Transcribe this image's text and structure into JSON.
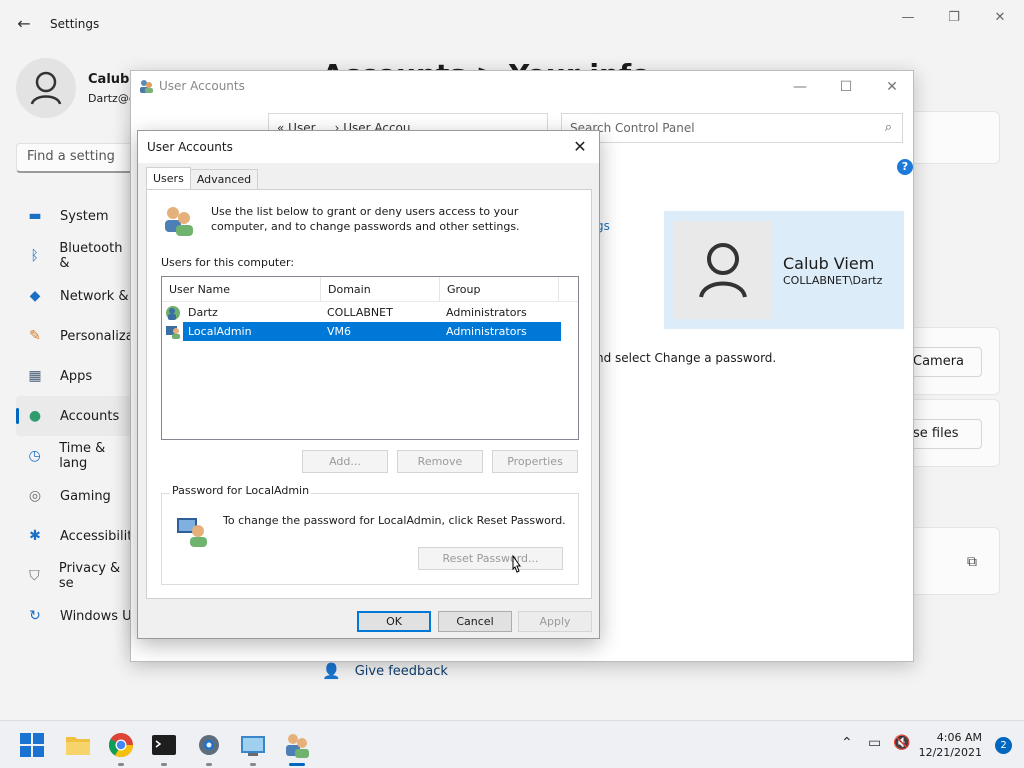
{
  "settings": {
    "title": "Settings",
    "user_name": "Calub V",
    "user_email": "Dartz@c",
    "search_placeholder": "Find a setting",
    "heading": "Accounts  >  Your info",
    "nav": [
      {
        "label": "System",
        "icon": "monitor-icon",
        "color": "#1a6fc4"
      },
      {
        "label": "Bluetooth &",
        "icon": "bluetooth-icon",
        "color": "#1a6fc4"
      },
      {
        "label": "Network &",
        "icon": "wifi-icon",
        "color": "#1a6fc4"
      },
      {
        "label": "Personaliza",
        "icon": "brush-icon",
        "color": "#d07a2a"
      },
      {
        "label": "Apps",
        "icon": "apps-icon",
        "color": "#4a6078"
      },
      {
        "label": "Accounts",
        "icon": "person-icon",
        "color": "#2e9c6c"
      },
      {
        "label": "Time & lang",
        "icon": "clock-globe-icon",
        "color": "#1a6fc4"
      },
      {
        "label": "Gaming",
        "icon": "gamepad-icon",
        "color": "#6b6b6b"
      },
      {
        "label": "Accessibilit",
        "icon": "accessibility-icon",
        "color": "#1a6fc4"
      },
      {
        "label": "Privacy & se",
        "icon": "shield-icon",
        "color": "#6b6b6b"
      },
      {
        "label": "Windows U",
        "icon": "update-icon",
        "color": "#1a6fc4"
      }
    ],
    "camera_button": "Camera",
    "browse_button": "se files",
    "give_feedback": "Give feedback"
  },
  "control_panel": {
    "title": "User Accounts",
    "address": "«  User ...  ›  User Accou...",
    "search_placeholder": "Search Control Panel",
    "help": "?",
    "gs_text": "gs",
    "change_password_text": "nd select Change a password.",
    "card_name": "Calub Viem",
    "card_domain": "COLLABNET\\Dartz"
  },
  "dialog": {
    "title": "User Accounts",
    "tabs": [
      "Users",
      "Advanced"
    ],
    "intro": "Use the list below to grant or deny users access to your computer, and to change passwords and other settings.",
    "users_label": "Users for this computer:",
    "columns": [
      "User Name",
      "Domain",
      "Group"
    ],
    "rows": [
      {
        "name": "Dartz",
        "domain": "COLLABNET",
        "group": "Administrators"
      },
      {
        "name": "LocalAdmin",
        "domain": "VM6",
        "group": "Administrators"
      }
    ],
    "selected_row": 1,
    "add_button": "Add...",
    "remove_button": "Remove",
    "properties_button": "Properties",
    "password_group_label": "Password for LocalAdmin",
    "password_text": "To change the password for LocalAdmin, click Reset Password.",
    "reset_button": "Reset Password...",
    "ok_button": "OK",
    "cancel_button": "Cancel",
    "apply_button": "Apply"
  },
  "taskbar": {
    "time": "4:06 AM",
    "date": "12/21/2021",
    "notifications": "2",
    "accent": "#0067c0"
  }
}
